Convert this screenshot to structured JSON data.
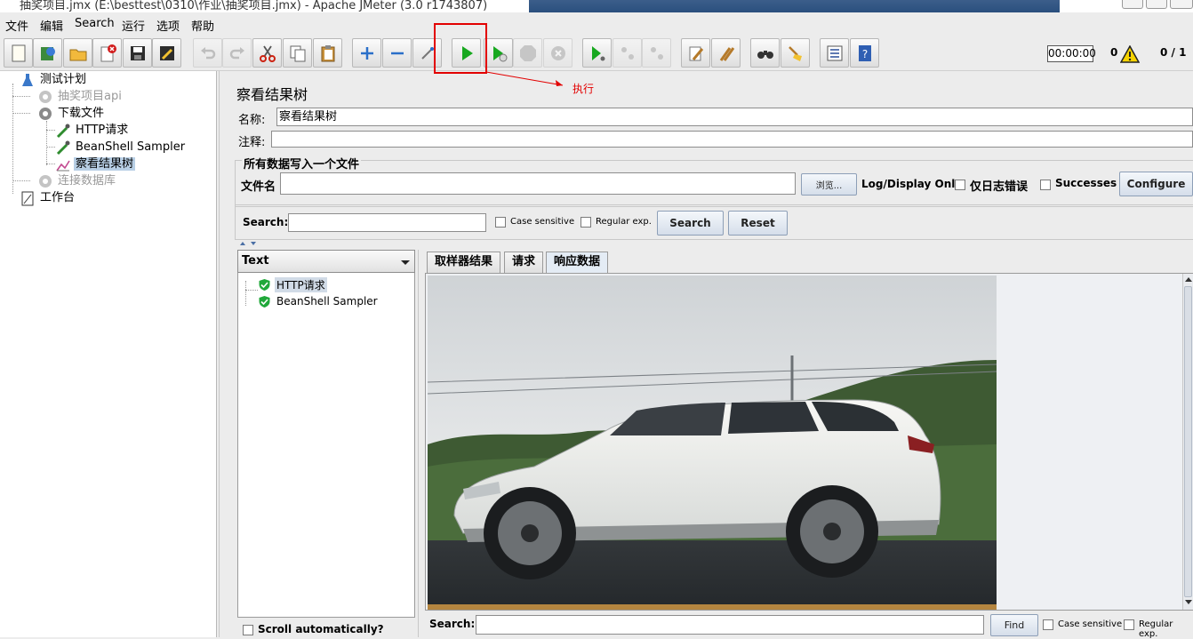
{
  "window": {
    "title": "抽奖项目.jmx (E:\\besttest\\0310\\作业\\抽奖项目.jmx) - Apache JMeter (3.0 r1743807)"
  },
  "menu": [
    "文件",
    "编辑",
    "Search",
    "运行",
    "选项",
    "帮助"
  ],
  "toolbar": {
    "timer": "00:00:00",
    "error_count": "0",
    "threads": "0 / 1",
    "buttons": [
      "new-icon",
      "templates-icon",
      "open-icon",
      "close-icon",
      "save-icon",
      "save-as-icon",
      "undo-icon",
      "redo-icon",
      "cut-icon",
      "copy-icon",
      "paste-icon",
      "expand-icon",
      "collapse-icon",
      "toggle-icon",
      "start-icon",
      "start-no-pause-icon",
      "stop-icon",
      "shutdown-icon",
      "remote-start-icon",
      "remote-stop-icon",
      "remote-shutdown-icon",
      "clear-icon",
      "clear-all-icon",
      "search-icon",
      "reset-search-icon",
      "function-helper-icon",
      "help-icon"
    ]
  },
  "annotation": {
    "text": "执行",
    "color": "#e20000"
  },
  "tree": {
    "items": [
      {
        "label": "测试计划"
      },
      {
        "label": "抽奖项目api",
        "disabled": true
      },
      {
        "label": "下载文件"
      },
      {
        "label": "HTTP请求"
      },
      {
        "label": "BeanShell Sampler"
      },
      {
        "label": "察看结果树",
        "selected": true
      },
      {
        "label": "连接数据库",
        "disabled": true
      },
      {
        "label": "工作台"
      }
    ]
  },
  "panel": {
    "title": "察看结果树",
    "name_label": "名称:",
    "name_value": "察看结果树",
    "comment_label": "注释:",
    "comment_value": "",
    "file_section": "所有数据写入一个文件",
    "filename_label": "文件名",
    "filename_value": "",
    "browse_label": "浏览...",
    "log_display_label": "Log/Display Only:",
    "errors_label": "仅日志错误",
    "successes_label": "Successes",
    "configure_label": "Configure"
  },
  "search": {
    "label": "Search:",
    "value": "",
    "case_sensitive": "Case sensitive",
    "regex": "Regular exp.",
    "search_button": "Search",
    "reset_button": "Reset"
  },
  "results": {
    "renderer": "Text",
    "samples": [
      "HTTP请求",
      "BeanShell Sampler"
    ],
    "scroll_auto": "Scroll automatically?"
  },
  "tabs": [
    "取样器结果",
    "请求",
    "响应数据"
  ],
  "response_search": {
    "label": "Search:",
    "find_button": "Find",
    "case_sensitive": "Case sensitive",
    "regex": "Regular exp."
  }
}
